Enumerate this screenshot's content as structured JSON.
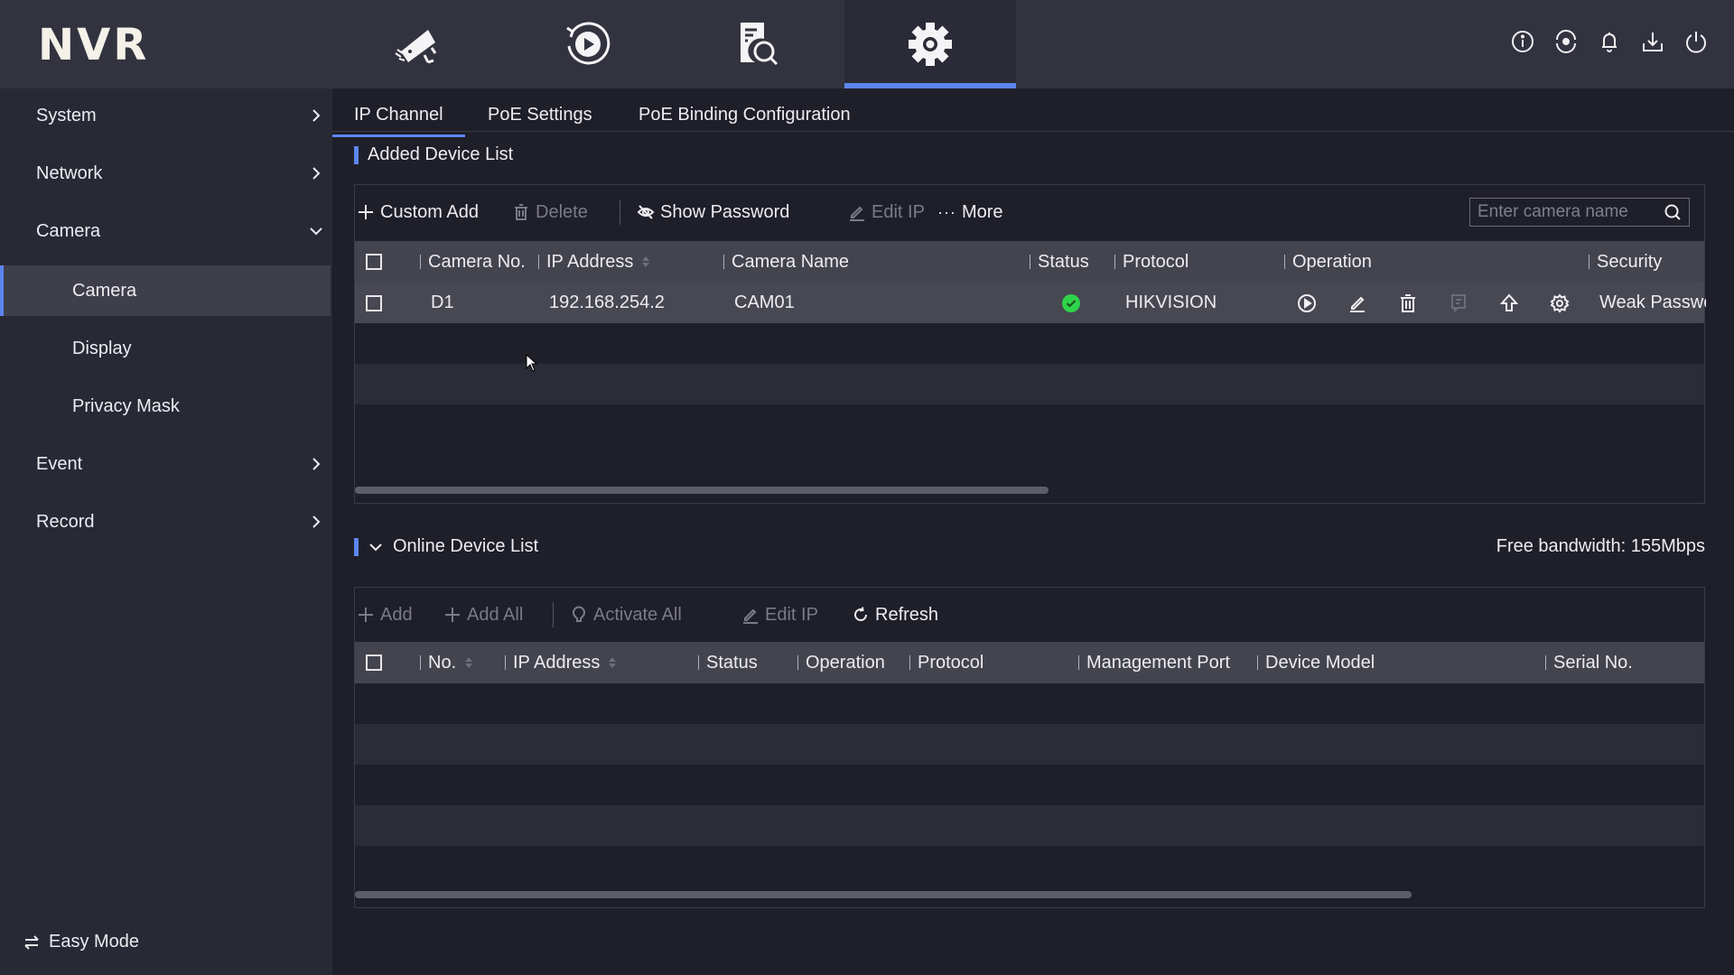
{
  "app": {
    "logo": "NVR",
    "nav": [
      {
        "name": "live-view",
        "icon": "camera-icon",
        "active": false
      },
      {
        "name": "playback",
        "icon": "playback-icon",
        "active": false
      },
      {
        "name": "search",
        "icon": "file-search-icon",
        "active": false
      },
      {
        "name": "configuration",
        "icon": "gear-icon",
        "active": true
      }
    ],
    "top_right_icons": [
      "info-icon",
      "record-status-icon",
      "bell-icon",
      "download-icon",
      "power-icon"
    ]
  },
  "sidebar": {
    "items": [
      {
        "label": "System",
        "level": 1,
        "chevron": "right"
      },
      {
        "label": "Network",
        "level": 1,
        "chevron": "right"
      },
      {
        "label": "Camera",
        "level": 1,
        "chevron": "down"
      },
      {
        "label": "Camera",
        "level": 2,
        "active": true
      },
      {
        "label": "Display",
        "level": 2
      },
      {
        "label": "Privacy Mask",
        "level": 2
      },
      {
        "label": "Event",
        "level": 1,
        "chevron": "right"
      },
      {
        "label": "Record",
        "level": 1,
        "chevron": "right"
      }
    ],
    "easy_mode": "Easy Mode"
  },
  "tabs": [
    {
      "label": "IP Channel",
      "active": true
    },
    {
      "label": "PoE Settings",
      "active": false
    },
    {
      "label": "PoE Binding Configuration",
      "active": false
    }
  ],
  "added": {
    "title": "Added Device List",
    "toolbar": {
      "custom_add": "Custom Add",
      "delete": "Delete",
      "show_password": "Show Password",
      "edit_ip": "Edit IP",
      "more": "More"
    },
    "search_placeholder": "Enter camera name",
    "columns": [
      "Camera No.",
      "IP Address",
      "Camera Name",
      "Status",
      "Protocol",
      "Operation",
      "Security"
    ],
    "rows": [
      {
        "camera_no": "D1",
        "ip": "192.168.254.2",
        "name": "CAM01",
        "status": "online",
        "protocol": "HIKVISION",
        "security": "Weak Password"
      }
    ],
    "status_color": "#2fd34a",
    "operations": [
      "play-icon",
      "edit-icon",
      "delete-icon",
      "message-icon",
      "upgrade-icon",
      "settings-icon"
    ]
  },
  "online": {
    "title": "Online Device List",
    "bandwidth": "Free bandwidth: 155Mbps",
    "toolbar": {
      "add": "Add",
      "add_all": "Add All",
      "activate_all": "Activate All",
      "edit_ip": "Edit IP",
      "refresh": "Refresh"
    },
    "columns": [
      "No.",
      "IP Address",
      "Status",
      "Operation",
      "Protocol",
      "Management Port",
      "Device Model",
      "Serial No."
    ],
    "rows": []
  },
  "colors": {
    "accent": "#5b86f0",
    "topbar": "#32333f",
    "sidebar": "#272a35",
    "main": "#1f1f2a"
  }
}
